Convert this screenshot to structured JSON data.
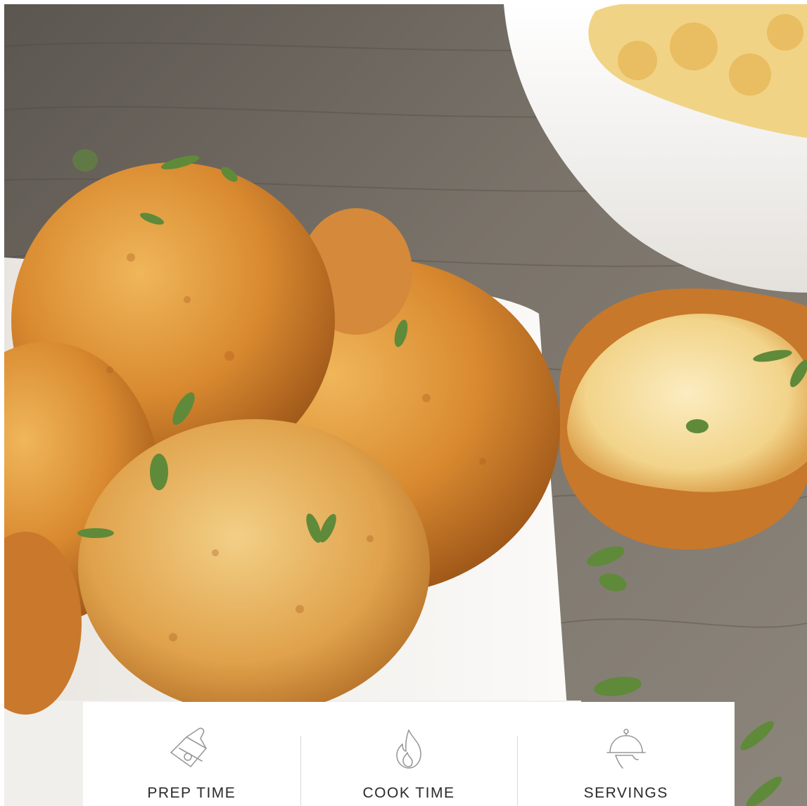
{
  "photo": {
    "subject": "fried-mac-and-cheese-balls",
    "colors": {
      "wood": "#6f6a63",
      "crust": "#d68a33",
      "plate": "#f4f2ef",
      "herb": "#5f8a3a",
      "bowl": "#f7f6f3"
    }
  },
  "stats": [
    {
      "label": "PREP TIME",
      "icon": "cutting-board-icon"
    },
    {
      "label": "COOK TIME",
      "icon": "flame-icon"
    },
    {
      "label": "SERVINGS",
      "icon": "serving-cloche-icon"
    }
  ],
  "colors": {
    "card": "#ffffff",
    "label_text": "#2a2a2a",
    "icon_stroke": "#9a9a9a",
    "divider": "#d9d9d9"
  }
}
